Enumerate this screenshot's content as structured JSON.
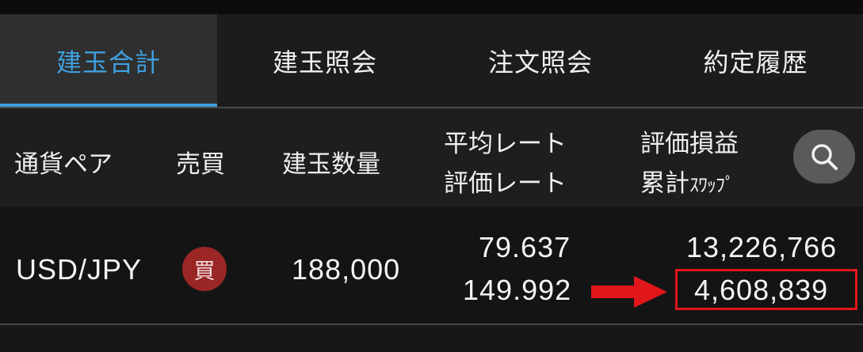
{
  "tabs": [
    {
      "label": "建玉合計",
      "active": true
    },
    {
      "label": "建玉照会",
      "active": false
    },
    {
      "label": "注文照会",
      "active": false
    },
    {
      "label": "約定履歴",
      "active": false
    }
  ],
  "header": {
    "currency_pair": "通貨ペア",
    "side": "売買",
    "quantity": "建玉数量",
    "avg_rate": "平均レート",
    "eval_rate": "評価レート",
    "eval_pl": "評価損益",
    "cumulative": "累計",
    "swap": "ｽﾜｯﾌﾟ"
  },
  "positions": [
    {
      "pair": "USD/JPY",
      "side": "買",
      "quantity": "188,000",
      "avg_rate": "79.637",
      "eval_rate": "149.992",
      "eval_pl": "13,226,766",
      "swap": "4,608,839"
    }
  ],
  "colors": {
    "accent": "#3ea0de",
    "buy_badge": "#9b2626",
    "highlight": "#e0161b"
  },
  "icons": {
    "search": "search-icon",
    "arrow": "arrow-right-icon"
  }
}
